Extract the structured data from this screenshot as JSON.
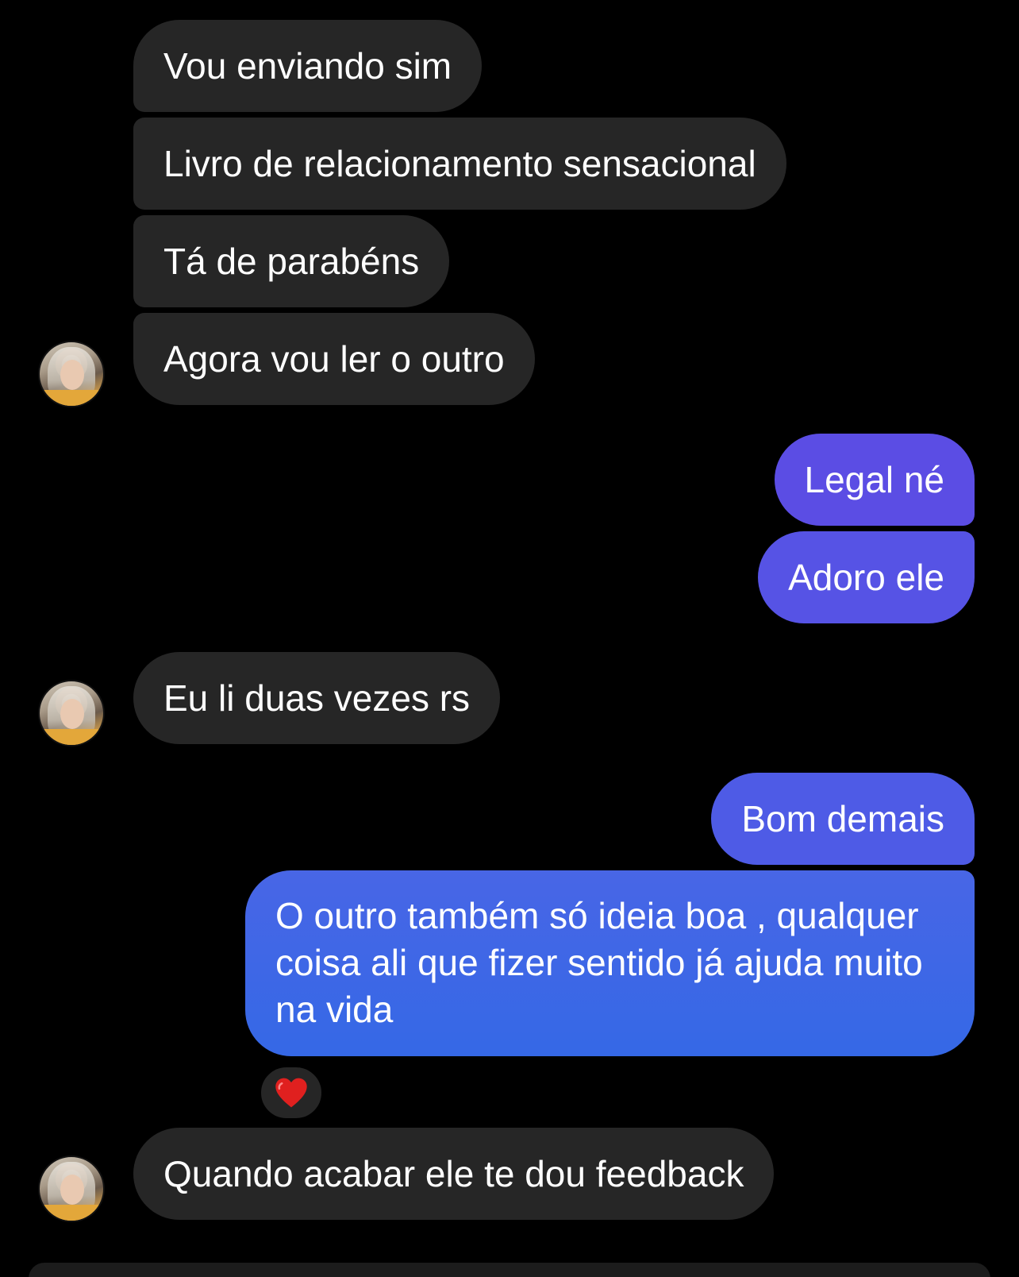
{
  "messages": {
    "in1": "Vou enviando sim",
    "in2": "Livro de relacionamento sensacional",
    "in3": "Tá de parabéns",
    "in4": "Agora vou ler o outro",
    "out1": "Legal né",
    "out2": "Adoro ele",
    "in5": "Eu li duas vezes rs",
    "out3": "Bom demais",
    "out4_line1": "O outro também só ideia boa , qualquer",
    "out4_line2": "coisa ali que fizer sentido já ajuda muito",
    "out4_line3": "na vida",
    "in6": "Quando acabar ele te dou feedback"
  },
  "reaction": {
    "icon": "heart-icon",
    "color": "#e0201f"
  },
  "colors": {
    "incoming_bubble": "#262626",
    "outgoing_purple": "#5a4fe3",
    "outgoing_blue": "#3a62e6",
    "background": "#000000"
  }
}
